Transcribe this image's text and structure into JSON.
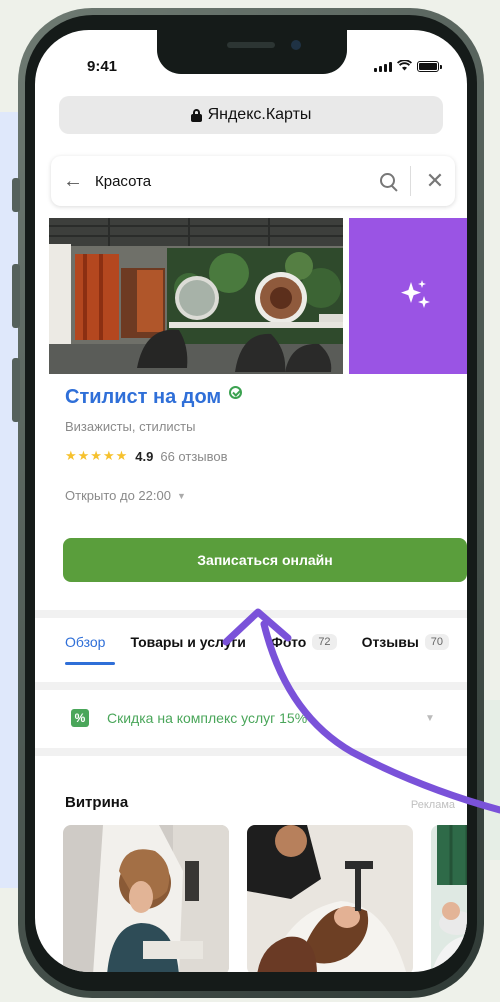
{
  "status_bar": {
    "time": "9:41",
    "icons": [
      "signal-icon",
      "wifi-icon",
      "battery-icon"
    ]
  },
  "browser": {
    "url": "Яндекс.Карты"
  },
  "search": {
    "query": "Красота",
    "back_icon": "arrow-left-icon",
    "search_icon": "search-icon",
    "close_icon": "close-icon"
  },
  "gallery": {
    "tile_icon": "sparkles-icon",
    "tile_color": "#9a54e4"
  },
  "place": {
    "name": "Стилист на дом",
    "category": "Визажисты, стилисты",
    "stars": "★★★★★",
    "rating": "4.9",
    "reviews": "66 отзывов",
    "hours": "Открыто до 22:00",
    "hours_chevron": "▼",
    "cta": "Записаться онлайн"
  },
  "tabs": [
    {
      "label": "Обзор",
      "count": ""
    },
    {
      "label": "Товары и услуги",
      "count": ""
    },
    {
      "label": "Фото",
      "count": "72"
    },
    {
      "label": "Отзывы",
      "count": "70"
    }
  ],
  "promo": {
    "icon": "%",
    "text": "Скидка на комплекс услуг 15%",
    "chevron": "▼"
  },
  "showcase": {
    "title": "Витрина",
    "ad_label": "Реклама"
  },
  "colors": {
    "accent_blue": "#2f6fd8",
    "button_green": "#5a9e3c",
    "promo_green": "#4aa65a",
    "arrow_purple": "#7a52d9",
    "star_yellow": "#f6c12d"
  }
}
